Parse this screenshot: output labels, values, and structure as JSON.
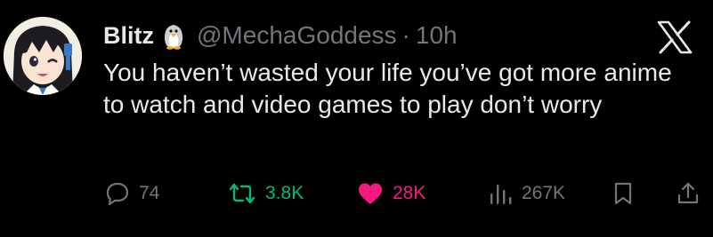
{
  "tweet": {
    "author": {
      "display_name": "Blitz",
      "badge_icon": "penguin-emoji-icon",
      "handle": "@MechaGoddess",
      "separator": "·",
      "time": "10h",
      "avatar_icon": "anime-girl-avatar"
    },
    "platform_icon": "x-logo-icon",
    "text": "You haven’t wasted your life you’ve got more anime to watch and video games to play don’t worry",
    "actions": {
      "reply": {
        "icon": "reply-icon",
        "count": "74"
      },
      "retweet": {
        "icon": "retweet-icon",
        "count": "3.8K",
        "color": "#00ba7c"
      },
      "like": {
        "icon": "heart-icon",
        "count": "28K",
        "color": "#f91880"
      },
      "views": {
        "icon": "views-icon",
        "count": "267K"
      },
      "bookmark": {
        "icon": "bookmark-icon"
      },
      "share": {
        "icon": "share-icon"
      }
    }
  },
  "colors": {
    "background": "#000000",
    "primary_text": "#e7e9ea",
    "secondary_text": "#71767b"
  }
}
